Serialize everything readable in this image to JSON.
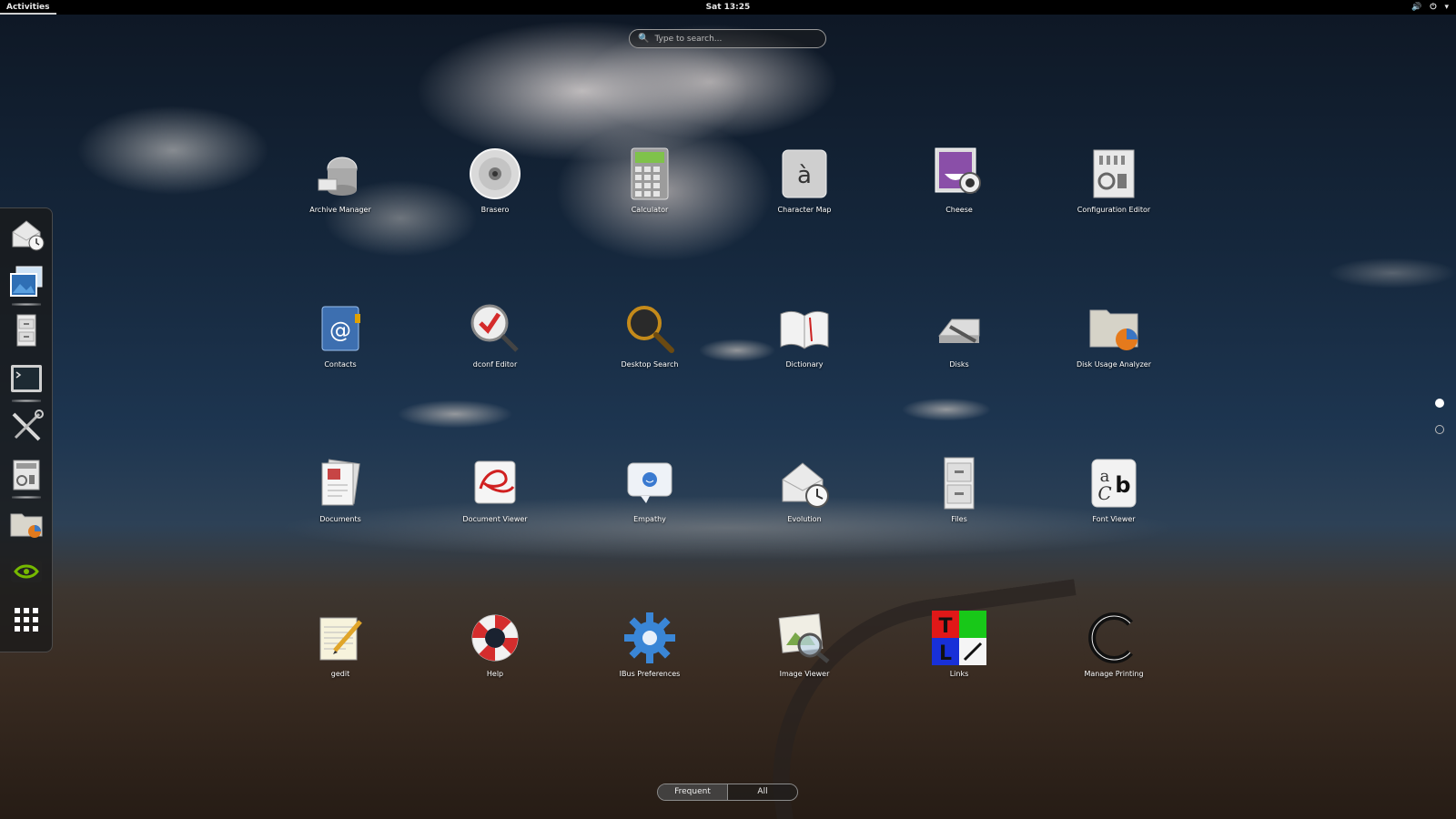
{
  "topbar": {
    "activities": "Activities",
    "clock": "Sat 13:25",
    "tray": {
      "volume_icon": "speaker-icon",
      "power_icon": "power-icon",
      "menu_icon": "chevron-down-icon"
    }
  },
  "search": {
    "placeholder": "Type to search..."
  },
  "dash": {
    "items": [
      {
        "name": "evolution",
        "icon": "mail-clock-icon",
        "running": false
      },
      {
        "name": "image-viewer",
        "icon": "photos-icon",
        "running": true
      },
      {
        "name": "files",
        "icon": "file-cabinet-icon",
        "running": false
      },
      {
        "name": "terminal",
        "icon": "terminal-icon",
        "running": true
      },
      {
        "name": "utilities",
        "icon": "tools-icon",
        "running": false
      },
      {
        "name": "configuration",
        "icon": "config-icon",
        "running": true
      },
      {
        "name": "disk-usage",
        "icon": "folder-chart-icon",
        "running": false
      },
      {
        "name": "nvidia",
        "icon": "nvidia-icon",
        "running": false
      },
      {
        "name": "show-apps",
        "icon": "grid-icon",
        "running": false
      }
    ]
  },
  "apps": [
    {
      "label": "Archive Manager",
      "icon": "archive-icon"
    },
    {
      "label": "Brasero",
      "icon": "disc-icon"
    },
    {
      "label": "Calculator",
      "icon": "calculator-icon"
    },
    {
      "label": "Character Map",
      "icon": "character-map-icon"
    },
    {
      "label": "Cheese",
      "icon": "cheese-icon"
    },
    {
      "label": "Configuration Editor",
      "icon": "config-editor-icon"
    },
    {
      "label": "Contacts",
      "icon": "contacts-icon"
    },
    {
      "label": "dconf Editor",
      "icon": "dconf-icon"
    },
    {
      "label": "Desktop Search",
      "icon": "magnifier-icon"
    },
    {
      "label": "Dictionary",
      "icon": "book-icon"
    },
    {
      "label": "Disks",
      "icon": "disks-icon"
    },
    {
      "label": "Disk Usage Analyzer",
      "icon": "disk-usage-icon"
    },
    {
      "label": "Documents",
      "icon": "documents-icon"
    },
    {
      "label": "Document Viewer",
      "icon": "document-viewer-icon"
    },
    {
      "label": "Empathy",
      "icon": "chat-icon"
    },
    {
      "label": "Evolution",
      "icon": "evolution-icon"
    },
    {
      "label": "Files",
      "icon": "cabinet-icon"
    },
    {
      "label": "Font Viewer",
      "icon": "font-icon"
    },
    {
      "label": "gedit",
      "icon": "text-editor-icon"
    },
    {
      "label": "Help",
      "icon": "lifebuoy-icon"
    },
    {
      "label": "IBus Preferences",
      "icon": "gear-icon"
    },
    {
      "label": "Image Viewer",
      "icon": "image-viewer-icon"
    },
    {
      "label": "Links",
      "icon": "links-icon"
    },
    {
      "label": "Manage Printing",
      "icon": "printing-icon"
    }
  ],
  "pages": {
    "current": 1,
    "total": 2
  },
  "view_switch": {
    "frequent": "Frequent",
    "all": "All",
    "selected": "Frequent"
  },
  "colors": {
    "topbar": "#000000",
    "dash": "#191919",
    "accent": "#ffffff"
  }
}
